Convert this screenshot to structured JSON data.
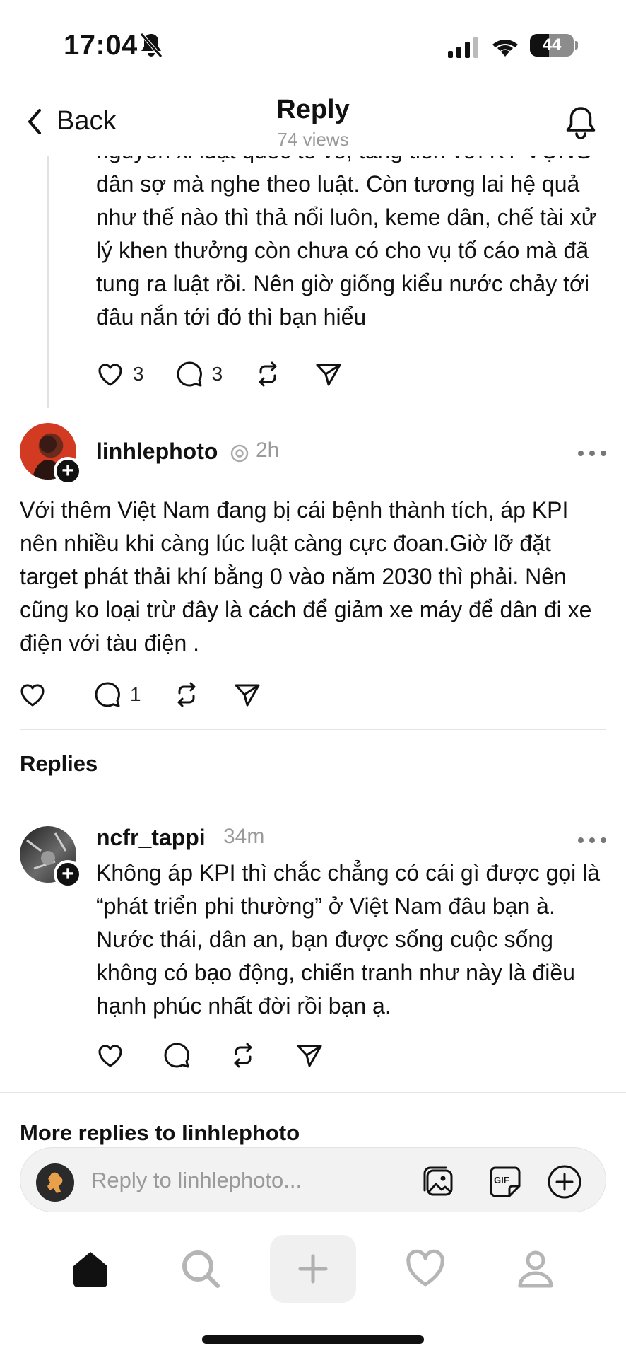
{
  "status_bar": {
    "time": "17:04",
    "battery": "44",
    "battery_percent": 44
  },
  "header": {
    "back_label": "Back",
    "title": "Reply",
    "views": "74 views"
  },
  "previous_post": {
    "text": "nguyên xi luật quốc tế vô, tăng tiền với KỲ VỌNG dân sợ mà nghe theo luật. Còn tương lai hệ quả như thế nào thì thả nổi luôn, keme dân, chế tài xử lý khen thưởng còn chưa có cho vụ tố cáo mà đã tung ra luật rồi. Nên giờ giống kiểu nước chảy tới đâu nắn tới đó thì bạn hiểu",
    "like_count": "3",
    "comment_count": "3"
  },
  "main_post": {
    "username": "linhlephoto",
    "time": "2h",
    "text": "Với thêm Việt Nam đang bị cái bệnh thành tích, áp KPI nên nhiều khi càng lúc luật càng cực đoan.Giờ lỡ đặt target phát thải khí bằng 0 vào năm 2030 thì phải. Nên cũng ko loại trừ đây là cách để giảm xe máy để dân đi xe điện với tàu điện .",
    "comment_count": "1"
  },
  "replies_section": {
    "title": "Replies"
  },
  "reply": {
    "username": "ncfr_tappi",
    "time": "34m",
    "text": "Không áp KPI thì chắc chẳng có cái gì được gọi là “phát triển phi thường” ở Việt Nam đâu bạn à. Nước thái, dân an, bạn được sống cuộc sống không có bạo động, chiến tranh như này là điều hạnh phúc nhất đời rồi bạn ạ."
  },
  "more_replies": {
    "title": "More replies to linhlephoto"
  },
  "reply_input": {
    "placeholder": "Reply to linhlephoto..."
  },
  "icons": [
    "bell-slash-icon",
    "signal-icon",
    "wifi-icon",
    "battery-icon",
    "chevron-left-icon",
    "bell-icon",
    "heart-icon",
    "comment-icon",
    "repost-icon",
    "send-icon",
    "more-icon",
    "plus-icon",
    "image-icon",
    "gif-icon",
    "plus-circle-icon",
    "home-icon",
    "search-icon",
    "compose-icon",
    "activity-heart-icon",
    "profile-icon"
  ]
}
